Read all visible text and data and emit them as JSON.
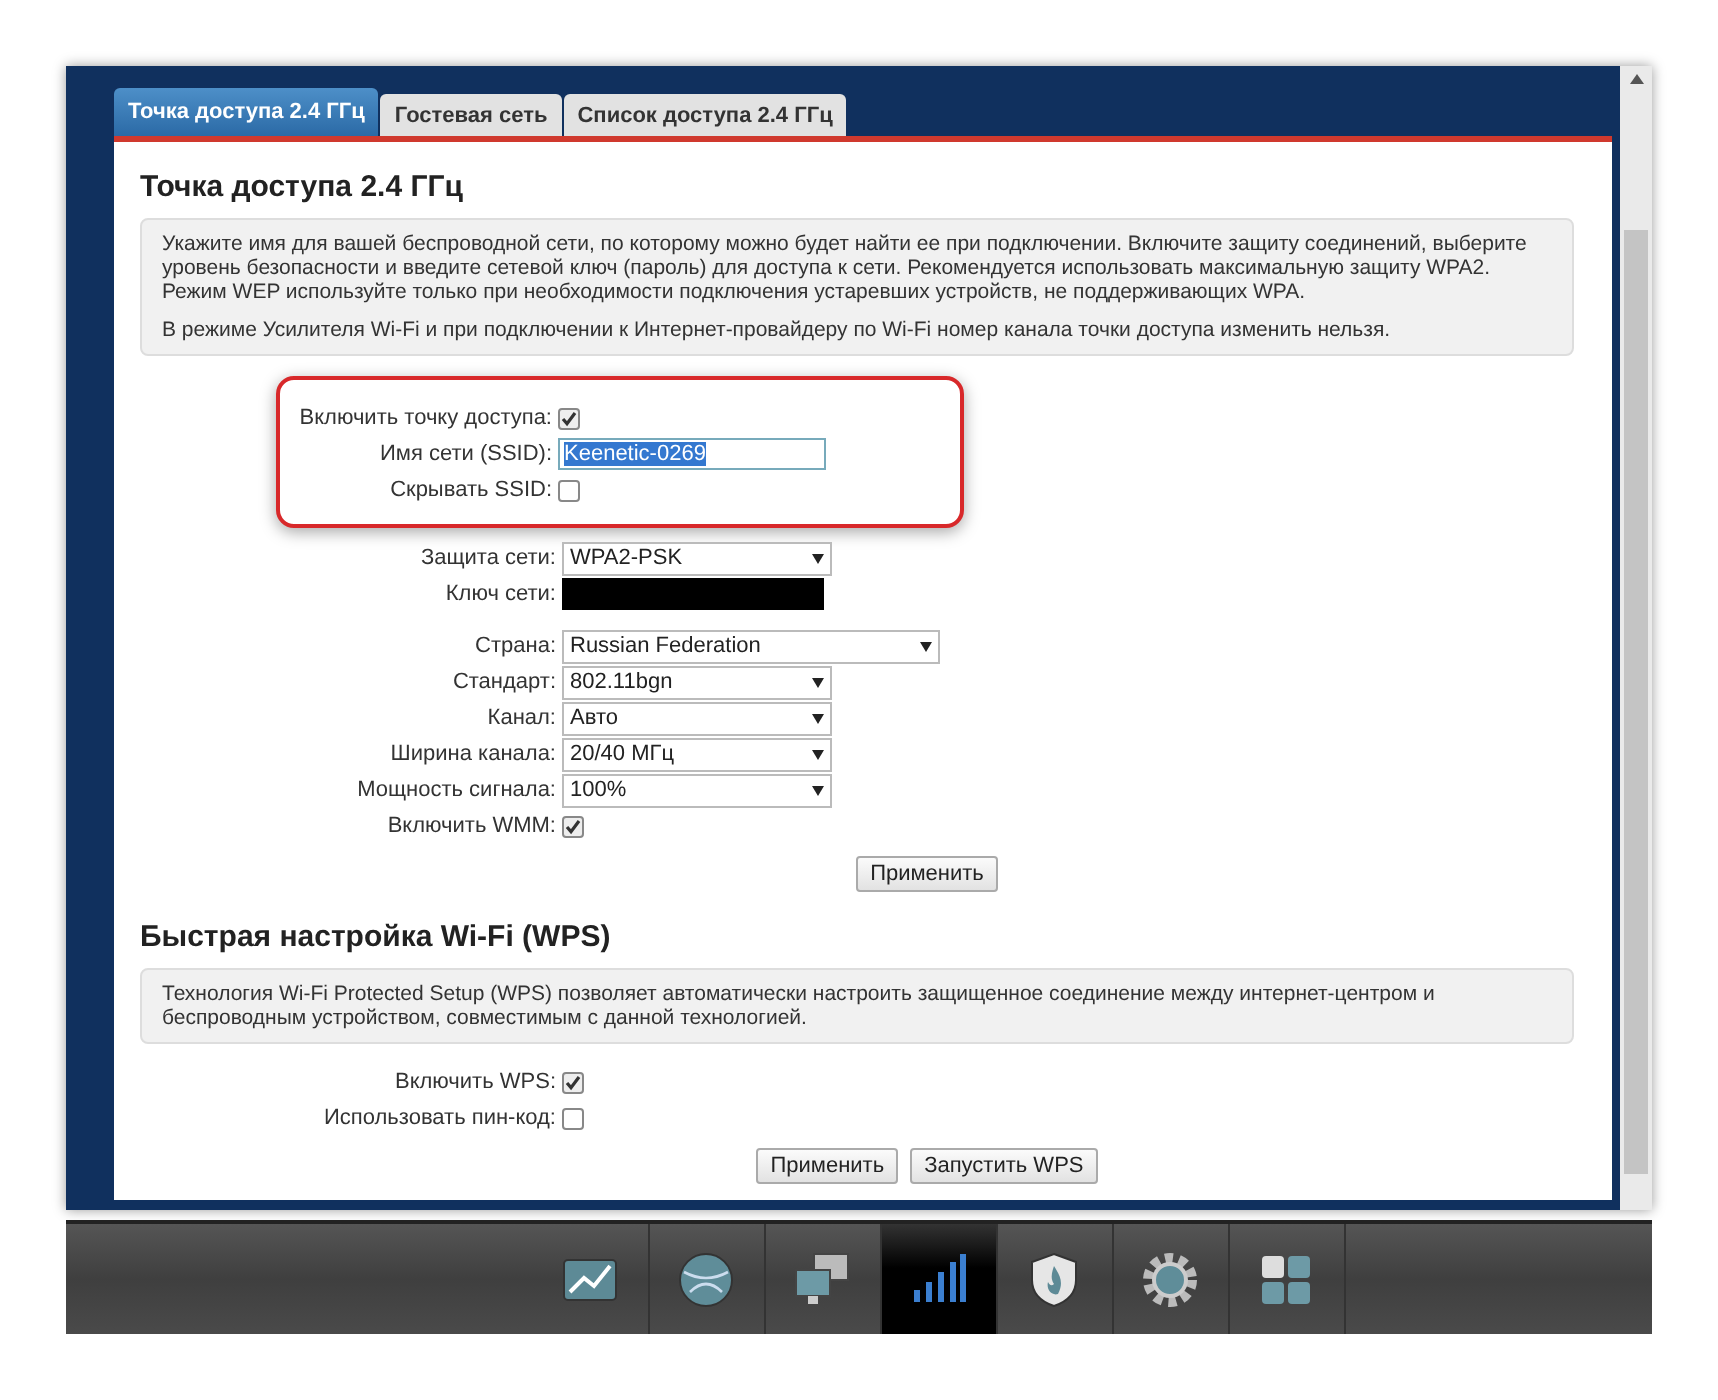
{
  "tabs": [
    {
      "label": "Точка доступа 2.4 ГГц",
      "selected": true
    },
    {
      "label": "Гостевая сеть",
      "selected": false
    },
    {
      "label": "Список доступа 2.4 ГГц",
      "selected": false
    }
  ],
  "sections": [
    {
      "title": "Точка доступа 2.4 ГГц",
      "info": [
        "Укажите имя для вашей беспроводной сети, по которому можно будет найти ее при подключении. Включите защиту соединений, выберите уровень безопасности и введите сетевой ключ (пароль) для доступа к сети. Рекомендуется использовать максимальную защиту WPA2. Режим WEP используйте только при необходимости подключения устаревших устройств, не поддерживающих WPA.",
        "В режиме Усилителя Wi-Fi и при подключении к Интернет-провайдеру по Wi-Fi номер канала точки доступа изменить нельзя."
      ],
      "fields": [
        {
          "kind": "checkbox",
          "label": "Включить точку доступа:",
          "checked": true,
          "highlighted": true
        },
        {
          "kind": "text",
          "label": "Имя сети (SSID):",
          "value": "Keenetic-0269",
          "text_selected": true,
          "highlighted": true
        },
        {
          "kind": "checkbox",
          "label": "Скрывать SSID:",
          "checked": false,
          "highlighted": true
        },
        {
          "kind": "select",
          "label": "Защита сети:",
          "value": "WPA2-PSK",
          "wide": false,
          "highlighted": false
        },
        {
          "kind": "password",
          "label": "Ключ сети:",
          "highlighted": false
        },
        {
          "kind": "gap"
        },
        {
          "kind": "select",
          "label": "Страна:",
          "value": "Russian Federation",
          "wide": true,
          "highlighted": false
        },
        {
          "kind": "select",
          "label": "Стандарт:",
          "value": "802.11bgn",
          "wide": false,
          "highlighted": false
        },
        {
          "kind": "select",
          "label": "Канал:",
          "value": "Авто",
          "wide": false,
          "highlighted": false
        },
        {
          "kind": "select",
          "label": "Ширина канала:",
          "value": "20/40 МГц",
          "wide": false,
          "highlighted": false
        },
        {
          "kind": "select",
          "label": "Мощность сигнала:",
          "value": "100%",
          "wide": false,
          "highlighted": false
        },
        {
          "kind": "checkbox",
          "label": "Включить WMM:",
          "checked": true,
          "highlighted": false
        }
      ],
      "buttons": [
        "Применить"
      ]
    },
    {
      "title": "Быстрая настройка Wi-Fi (WPS)",
      "info": [
        "Технология Wi-Fi Protected Setup (WPS) позволяет автоматически настроить защищенное соединение между интернет-центром и беспроводным устройством, совместимым с данной технологией."
      ],
      "fields": [
        {
          "kind": "checkbox",
          "label": "Включить WPS:",
          "checked": true,
          "highlighted": false
        },
        {
          "kind": "checkbox",
          "label": "Использовать пин-код:",
          "checked": false,
          "highlighted": false
        }
      ],
      "buttons": [
        "Применить",
        "Запустить WPS"
      ]
    }
  ],
  "dock": [
    {
      "kind": "chart",
      "selected": false
    },
    {
      "kind": "globe",
      "selected": false
    },
    {
      "kind": "computers",
      "selected": false
    },
    {
      "kind": "signal",
      "selected": true
    },
    {
      "kind": "shield",
      "selected": false
    },
    {
      "kind": "gear",
      "selected": false
    },
    {
      "kind": "grid",
      "selected": false
    }
  ]
}
